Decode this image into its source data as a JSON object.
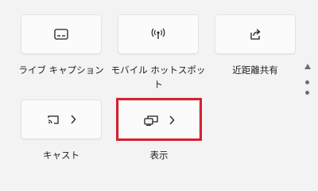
{
  "tiles": [
    {
      "label": "ライブ キャプション",
      "icon": "live-captions-icon",
      "has_chevron": false
    },
    {
      "label": "モバイル ホットスポット",
      "icon": "mobile-hotspot-icon",
      "has_chevron": false
    },
    {
      "label": "近距離共有",
      "icon": "nearby-share-icon",
      "has_chevron": false
    },
    {
      "label": "キャスト",
      "icon": "cast-icon",
      "has_chevron": true
    },
    {
      "label": "表示",
      "icon": "project-display-icon",
      "has_chevron": true,
      "highlighted": true
    }
  ],
  "colors": {
    "panel_bg": "#f3f3f3",
    "tile_bg": "#fbfbfb",
    "highlight": "#d6202f",
    "scroll": "#6e6e6e"
  },
  "scroll": {
    "up_icon": "scroll-up-icon",
    "page_count": 2
  }
}
